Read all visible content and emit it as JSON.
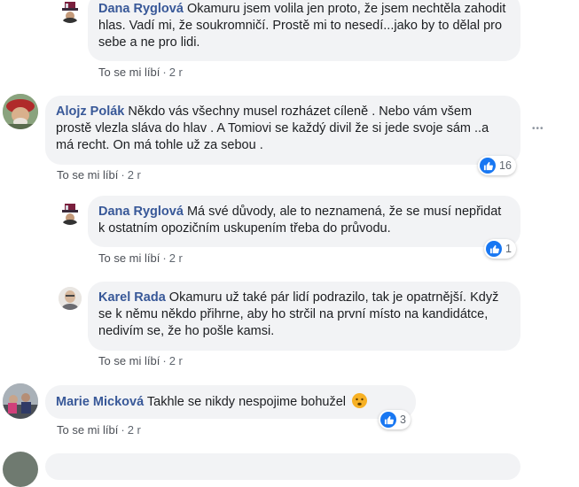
{
  "comments": [
    {
      "author": "Dana Ryglová",
      "text": "Okamuru jsem volila jen proto, že jsem nechtěla zahodit hlas. Vadí mi, že soukromničí. Prostě mi to nesedí...jako by to dělal pro sebe a ne pro lidi.",
      "like_label": "To se mi líbí",
      "time": "2 r"
    },
    {
      "author": "Alojz Polák",
      "text": "Někdo vás všechny musel rozházet cíleně . Nebo vám všem prostě vlezla sláva do hlav . A Tomiovi se každý divil že si jede svoje sám ..a má recht. On má tohle už za sebou .",
      "like_label": "To se mi líbí",
      "time": "2 r",
      "reactions": "16",
      "more_icon": "•••"
    },
    {
      "author": "Dana Ryglová",
      "text": "Má své důvody, ale to neznamená, že se musí nepřidat k ostatním opozičním uskupením třeba do průvodu.",
      "like_label": "To se mi líbí",
      "time": "2 r",
      "reactions": "1"
    },
    {
      "author": "Karel Rada",
      "text": "Okamuru už také pár lidí podrazilo, tak je opatrnější. Když se k němu někdo přihrne, aby ho strčil na první místo na kandidátce, nedivím se, že ho pošle kamsi.",
      "like_label": "To se mi líbí",
      "time": "2 r"
    },
    {
      "author": "Marie Micková",
      "text": "Takhle se nikdy nespojime bohužel",
      "like_label": "To se mi líbí",
      "time": "2 r",
      "reactions": "3"
    }
  ],
  "separator": "·",
  "colors": {
    "author": "#385898",
    "bubble": "#f2f3f5",
    "like_blue": "#1877f2"
  }
}
